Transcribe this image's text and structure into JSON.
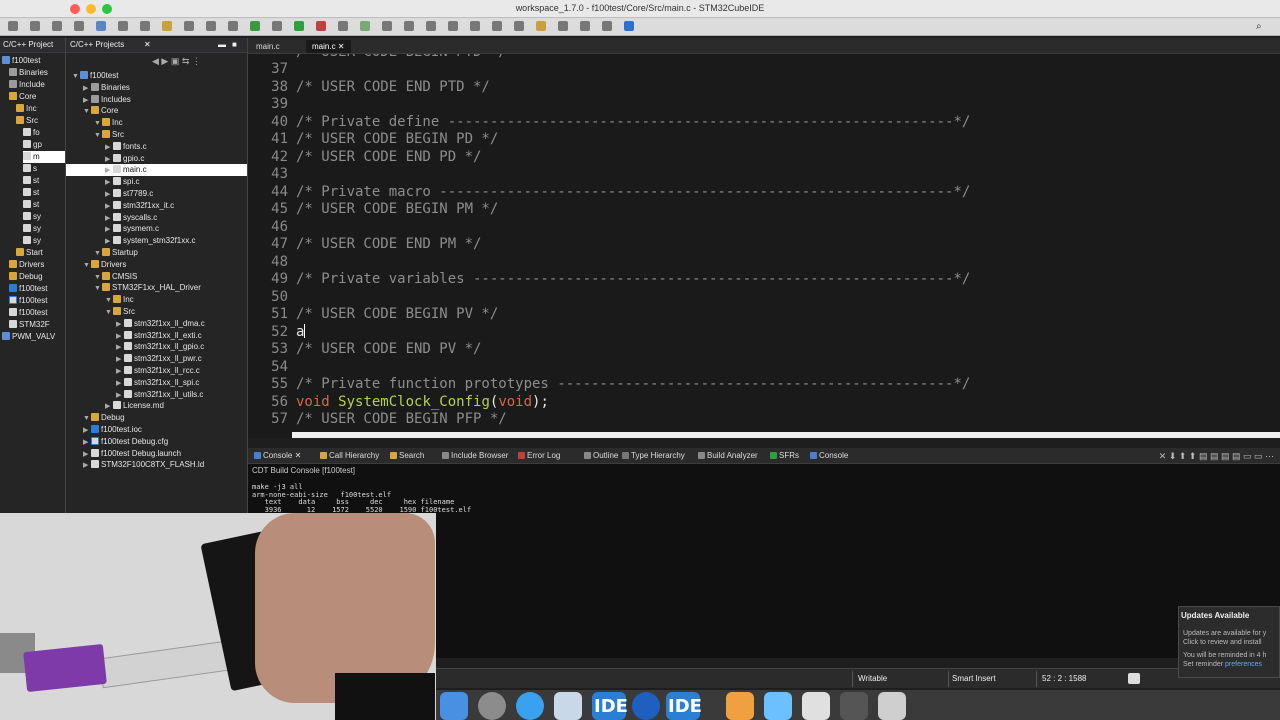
{
  "window": {
    "title": "workspace_1.7.0 - f100test/Core/Src/main.c - STM32CubeIDE"
  },
  "explorer1": {
    "tab_label": "C/C++ Project",
    "items": [
      "f100test",
      "Binaries",
      "Include",
      "Core",
      "Inc",
      "Src",
      "fo",
      "gp",
      "m",
      "s",
      "st",
      "st",
      "st",
      "sy",
      "sy",
      "sy",
      "Start",
      "Drivers",
      "Debug",
      "f100test",
      "f100test",
      "f100test",
      "STM32F",
      "PWM_VALV"
    ]
  },
  "explorer2": {
    "tab_label": "C/C++ Projects",
    "items": [
      {
        "label": "f100test",
        "icon": "proj"
      },
      {
        "label": "Binaries",
        "icon": "bin"
      },
      {
        "label": "Includes",
        "icon": "bin"
      },
      {
        "label": "Core",
        "icon": "folder"
      },
      {
        "label": "Inc",
        "icon": "folder"
      },
      {
        "label": "Src",
        "icon": "folder"
      },
      {
        "label": "fonts.c",
        "icon": "file"
      },
      {
        "label": "gpio.c",
        "icon": "file"
      },
      {
        "label": "main.c",
        "icon": "file"
      },
      {
        "label": "spi.c",
        "icon": "file"
      },
      {
        "label": "st7789.c",
        "icon": "file"
      },
      {
        "label": "stm32f1xx_it.c",
        "icon": "file"
      },
      {
        "label": "syscalls.c",
        "icon": "file"
      },
      {
        "label": "sysmem.c",
        "icon": "file"
      },
      {
        "label": "system_stm32f1xx.c",
        "icon": "file"
      },
      {
        "label": "Startup",
        "icon": "folder"
      },
      {
        "label": "Drivers",
        "icon": "folder"
      },
      {
        "label": "CMSIS",
        "icon": "folder"
      },
      {
        "label": "STM32F1xx_HAL_Driver",
        "icon": "folder"
      },
      {
        "label": "Inc",
        "icon": "folder"
      },
      {
        "label": "Src",
        "icon": "folder"
      },
      {
        "label": "stm32f1xx_ll_dma.c",
        "icon": "file"
      },
      {
        "label": "stm32f1xx_ll_exti.c",
        "icon": "file"
      },
      {
        "label": "stm32f1xx_ll_gpio.c",
        "icon": "file"
      },
      {
        "label": "stm32f1xx_ll_pwr.c",
        "icon": "file"
      },
      {
        "label": "stm32f1xx_ll_rcc.c",
        "icon": "file"
      },
      {
        "label": "stm32f1xx_ll_spi.c",
        "icon": "file"
      },
      {
        "label": "stm32f1xx_ll_utils.c",
        "icon": "file"
      },
      {
        "label": "License.md",
        "icon": "file"
      },
      {
        "label": "Debug",
        "icon": "folder"
      },
      {
        "label": "f100test.ioc",
        "icon": "launch"
      },
      {
        "label": "f100test Debug.cfg",
        "icon": "cfg"
      },
      {
        "label": "f100test Debug.launch",
        "icon": "file"
      },
      {
        "label": "STM32F100C8TX_FLASH.ld",
        "icon": "file"
      }
    ]
  },
  "editor": {
    "tabs": [
      "main.c",
      "main.c"
    ],
    "lines": [
      {
        "n": "37",
        "text": ""
      },
      {
        "n": "38",
        "text": "/* USER CODE END PTD */"
      },
      {
        "n": "39",
        "text": ""
      },
      {
        "n": "40",
        "text": "/* Private define ------------------------------------------------------------*/"
      },
      {
        "n": "41",
        "text": "/* USER CODE BEGIN PD */"
      },
      {
        "n": "42",
        "text": "/* USER CODE END PD */"
      },
      {
        "n": "43",
        "text": ""
      },
      {
        "n": "44",
        "text": "/* Private macro -------------------------------------------------------------*/"
      },
      {
        "n": "45",
        "text": "/* USER CODE BEGIN PM */"
      },
      {
        "n": "46",
        "text": ""
      },
      {
        "n": "47",
        "text": "/* USER CODE END PM */"
      },
      {
        "n": "48",
        "text": ""
      },
      {
        "n": "49",
        "text": "/* Private variables ---------------------------------------------------------*/"
      },
      {
        "n": "50",
        "text": ""
      },
      {
        "n": "51",
        "text": "/* USER CODE BEGIN PV */"
      },
      {
        "n": "52",
        "text": "a"
      },
      {
        "n": "53",
        "text": "/* USER CODE END PV */"
      },
      {
        "n": "54",
        "text": ""
      },
      {
        "n": "55",
        "text": "/* Private function prototypes -----------------------------------------------*/"
      },
      {
        "n": "56",
        "text": "void SystemClock_Config(void);"
      },
      {
        "n": "57",
        "text": "/* USER CODE BEGIN PFP */"
      }
    ],
    "top_partial": "/* USER CODE BEGIN PTD */"
  },
  "console": {
    "tabs": [
      "Console",
      "Call Hierarchy",
      "Search",
      "Include Browser",
      "Error Log",
      "Outline",
      "Type Hierarchy",
      "Build Analyzer",
      "SFRs",
      "Console"
    ],
    "header": "CDT Build Console [f100test]",
    "output": [
      "make -j3 all",
      "arm-none-eabi-size   f100test.elf",
      "   text    data     bss     dec     hex filename",
      "   3936      12    1572    5520    1590 f100test.elf"
    ]
  },
  "statusbar": {
    "writable": "Writable",
    "insert": "Smart Insert",
    "position": "52 : 2 : 1588"
  },
  "updates": {
    "title": "Updates Available",
    "line1": "Updates are available for y",
    "line2": "Click to review and install",
    "line3": "You will be reminded in 4 h",
    "line4_prefix": "Set reminder ",
    "link": "preferences"
  },
  "dock": {
    "ide_label": "IDE"
  }
}
